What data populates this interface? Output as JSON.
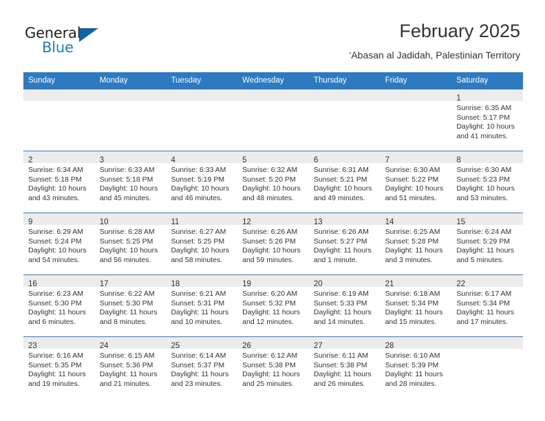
{
  "logo": {
    "word_top": "General",
    "word_bottom": "Blue",
    "triangle_color": "#0e63a8",
    "blue_text_color": "#1a7ec8"
  },
  "header": {
    "title": "February 2025",
    "subtitle": "‘Abasan al Jadidah, Palestinian Territory"
  },
  "theme": {
    "header_blue": "#2e7ac1",
    "day_band_gray": "#ececec",
    "text_color": "#333333"
  },
  "weekdays": [
    "Sunday",
    "Monday",
    "Tuesday",
    "Wednesday",
    "Thursday",
    "Friday",
    "Saturday"
  ],
  "weeks": [
    [
      {
        "day": "",
        "empty": true
      },
      {
        "day": "",
        "empty": true
      },
      {
        "day": "",
        "empty": true
      },
      {
        "day": "",
        "empty": true
      },
      {
        "day": "",
        "empty": true
      },
      {
        "day": "",
        "empty": true
      },
      {
        "day": "1",
        "sunrise": "Sunrise: 6:35 AM",
        "sunset": "Sunset: 5:17 PM",
        "daylight": "Daylight: 10 hours and 41 minutes."
      }
    ],
    [
      {
        "day": "2",
        "sunrise": "Sunrise: 6:34 AM",
        "sunset": "Sunset: 5:18 PM",
        "daylight": "Daylight: 10 hours and 43 minutes."
      },
      {
        "day": "3",
        "sunrise": "Sunrise: 6:33 AM",
        "sunset": "Sunset: 5:18 PM",
        "daylight": "Daylight: 10 hours and 45 minutes."
      },
      {
        "day": "4",
        "sunrise": "Sunrise: 6:33 AM",
        "sunset": "Sunset: 5:19 PM",
        "daylight": "Daylight: 10 hours and 46 minutes."
      },
      {
        "day": "5",
        "sunrise": "Sunrise: 6:32 AM",
        "sunset": "Sunset: 5:20 PM",
        "daylight": "Daylight: 10 hours and 48 minutes."
      },
      {
        "day": "6",
        "sunrise": "Sunrise: 6:31 AM",
        "sunset": "Sunset: 5:21 PM",
        "daylight": "Daylight: 10 hours and 49 minutes."
      },
      {
        "day": "7",
        "sunrise": "Sunrise: 6:30 AM",
        "sunset": "Sunset: 5:22 PM",
        "daylight": "Daylight: 10 hours and 51 minutes."
      },
      {
        "day": "8",
        "sunrise": "Sunrise: 6:30 AM",
        "sunset": "Sunset: 5:23 PM",
        "daylight": "Daylight: 10 hours and 53 minutes."
      }
    ],
    [
      {
        "day": "9",
        "sunrise": "Sunrise: 6:29 AM",
        "sunset": "Sunset: 5:24 PM",
        "daylight": "Daylight: 10 hours and 54 minutes."
      },
      {
        "day": "10",
        "sunrise": "Sunrise: 6:28 AM",
        "sunset": "Sunset: 5:25 PM",
        "daylight": "Daylight: 10 hours and 56 minutes."
      },
      {
        "day": "11",
        "sunrise": "Sunrise: 6:27 AM",
        "sunset": "Sunset: 5:25 PM",
        "daylight": "Daylight: 10 hours and 58 minutes."
      },
      {
        "day": "12",
        "sunrise": "Sunrise: 6:26 AM",
        "sunset": "Sunset: 5:26 PM",
        "daylight": "Daylight: 10 hours and 59 minutes."
      },
      {
        "day": "13",
        "sunrise": "Sunrise: 6:26 AM",
        "sunset": "Sunset: 5:27 PM",
        "daylight": "Daylight: 11 hours and 1 minute."
      },
      {
        "day": "14",
        "sunrise": "Sunrise: 6:25 AM",
        "sunset": "Sunset: 5:28 PM",
        "daylight": "Daylight: 11 hours and 3 minutes."
      },
      {
        "day": "15",
        "sunrise": "Sunrise: 6:24 AM",
        "sunset": "Sunset: 5:29 PM",
        "daylight": "Daylight: 11 hours and 5 minutes."
      }
    ],
    [
      {
        "day": "16",
        "sunrise": "Sunrise: 6:23 AM",
        "sunset": "Sunset: 5:30 PM",
        "daylight": "Daylight: 11 hours and 6 minutes."
      },
      {
        "day": "17",
        "sunrise": "Sunrise: 6:22 AM",
        "sunset": "Sunset: 5:30 PM",
        "daylight": "Daylight: 11 hours and 8 minutes."
      },
      {
        "day": "18",
        "sunrise": "Sunrise: 6:21 AM",
        "sunset": "Sunset: 5:31 PM",
        "daylight": "Daylight: 11 hours and 10 minutes."
      },
      {
        "day": "19",
        "sunrise": "Sunrise: 6:20 AM",
        "sunset": "Sunset: 5:32 PM",
        "daylight": "Daylight: 11 hours and 12 minutes."
      },
      {
        "day": "20",
        "sunrise": "Sunrise: 6:19 AM",
        "sunset": "Sunset: 5:33 PM",
        "daylight": "Daylight: 11 hours and 14 minutes."
      },
      {
        "day": "21",
        "sunrise": "Sunrise: 6:18 AM",
        "sunset": "Sunset: 5:34 PM",
        "daylight": "Daylight: 11 hours and 15 minutes."
      },
      {
        "day": "22",
        "sunrise": "Sunrise: 6:17 AM",
        "sunset": "Sunset: 5:34 PM",
        "daylight": "Daylight: 11 hours and 17 minutes."
      }
    ],
    [
      {
        "day": "23",
        "sunrise": "Sunrise: 6:16 AM",
        "sunset": "Sunset: 5:35 PM",
        "daylight": "Daylight: 11 hours and 19 minutes."
      },
      {
        "day": "24",
        "sunrise": "Sunrise: 6:15 AM",
        "sunset": "Sunset: 5:36 PM",
        "daylight": "Daylight: 11 hours and 21 minutes."
      },
      {
        "day": "25",
        "sunrise": "Sunrise: 6:14 AM",
        "sunset": "Sunset: 5:37 PM",
        "daylight": "Daylight: 11 hours and 23 minutes."
      },
      {
        "day": "26",
        "sunrise": "Sunrise: 6:12 AM",
        "sunset": "Sunset: 5:38 PM",
        "daylight": "Daylight: 11 hours and 25 minutes."
      },
      {
        "day": "27",
        "sunrise": "Sunrise: 6:11 AM",
        "sunset": "Sunset: 5:38 PM",
        "daylight": "Daylight: 11 hours and 26 minutes."
      },
      {
        "day": "28",
        "sunrise": "Sunrise: 6:10 AM",
        "sunset": "Sunset: 5:39 PM",
        "daylight": "Daylight: 11 hours and 28 minutes."
      },
      {
        "day": "",
        "empty": true
      }
    ]
  ]
}
